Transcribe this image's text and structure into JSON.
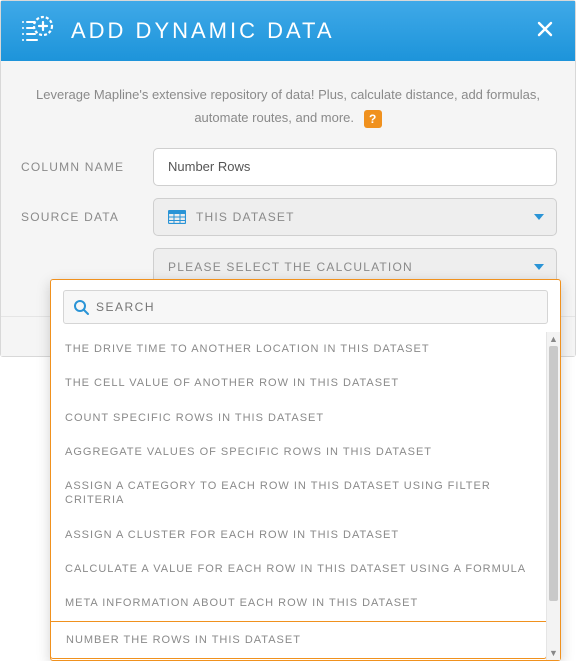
{
  "header": {
    "title": "ADD DYNAMIC DATA"
  },
  "description": {
    "text": "Leverage Mapline's extensive repository of data! Plus, calculate distance, add formulas, automate routes, and more.",
    "help_symbol": "?"
  },
  "form": {
    "column_name_label": "COLUMN NAME",
    "column_name_value": "Number Rows",
    "source_data_label": "SOURCE DATA",
    "source_data_value": "THIS DATASET",
    "calculation_placeholder": "PLEASE SELECT THE CALCULATION"
  },
  "dropdown": {
    "search_placeholder": "SEARCH",
    "items": [
      "THE DRIVE TIME TO ANOTHER LOCATION IN THIS DATASET",
      "THE CELL VALUE OF ANOTHER ROW IN THIS DATASET",
      "COUNT SPECIFIC ROWS IN THIS DATASET",
      "AGGREGATE VALUES OF SPECIFIC ROWS IN THIS DATASET",
      "ASSIGN A CATEGORY TO EACH ROW IN THIS DATASET USING FILTER CRITERIA",
      "ASSIGN A CLUSTER FOR EACH ROW IN THIS DATASET",
      "CALCULATE A VALUE FOR EACH ROW IN THIS DATASET USING A FORMULA",
      "META INFORMATION ABOUT EACH ROW IN THIS DATASET",
      "NUMBER THE ROWS IN THIS DATASET"
    ],
    "selected_index": 8
  },
  "colors": {
    "accent_blue": "#2a94d6",
    "accent_orange": "#f0911e"
  }
}
